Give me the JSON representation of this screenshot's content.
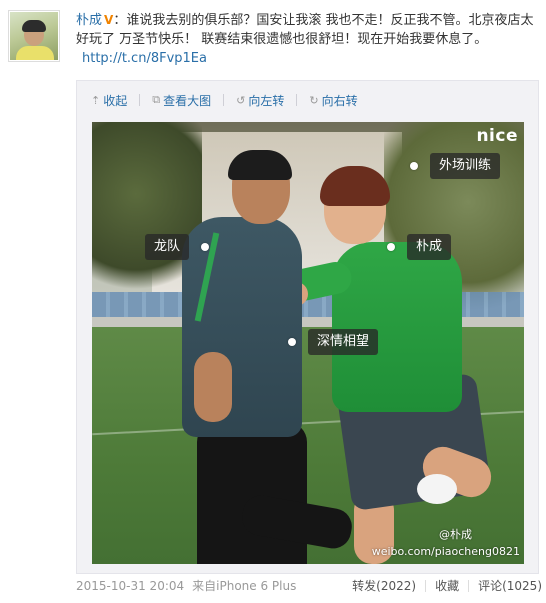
{
  "post": {
    "author": "朴成",
    "vip_badge": "V",
    "text": "：谁说我去别的俱乐部？国安让我滚 我也不走！反正我不管。北京夜店太好玩了 万圣节快乐！ 联赛结束很遗憾也很舒坦！现在开始我要休息了。",
    "link": "http://t.cn/8Fvp1Ea"
  },
  "toolbar": {
    "collapse": "收起",
    "view_large": "查看大图",
    "rotate_left": "向左转",
    "rotate_right": "向右转",
    "icons": [
      "arrow-up-icon",
      "magnify-icon",
      "rotate-left-icon",
      "rotate-right-icon"
    ]
  },
  "photo": {
    "brand": "nice",
    "watermark": "weibo.com/piaocheng0821",
    "watermark_logo": "@朴成",
    "tags": [
      "外场训练",
      "龙队",
      "朴成",
      "深情相望"
    ]
  },
  "meta": {
    "time": "2015-10-31 20:04",
    "source": "来自iPhone 6 Plus"
  },
  "actions": {
    "repost": "转发(2022)",
    "favorite": "收藏",
    "comment": "评论(1025)"
  },
  "colors": {
    "link": "#2a6fa8",
    "vip": "#f08300",
    "muted": "#999999"
  }
}
